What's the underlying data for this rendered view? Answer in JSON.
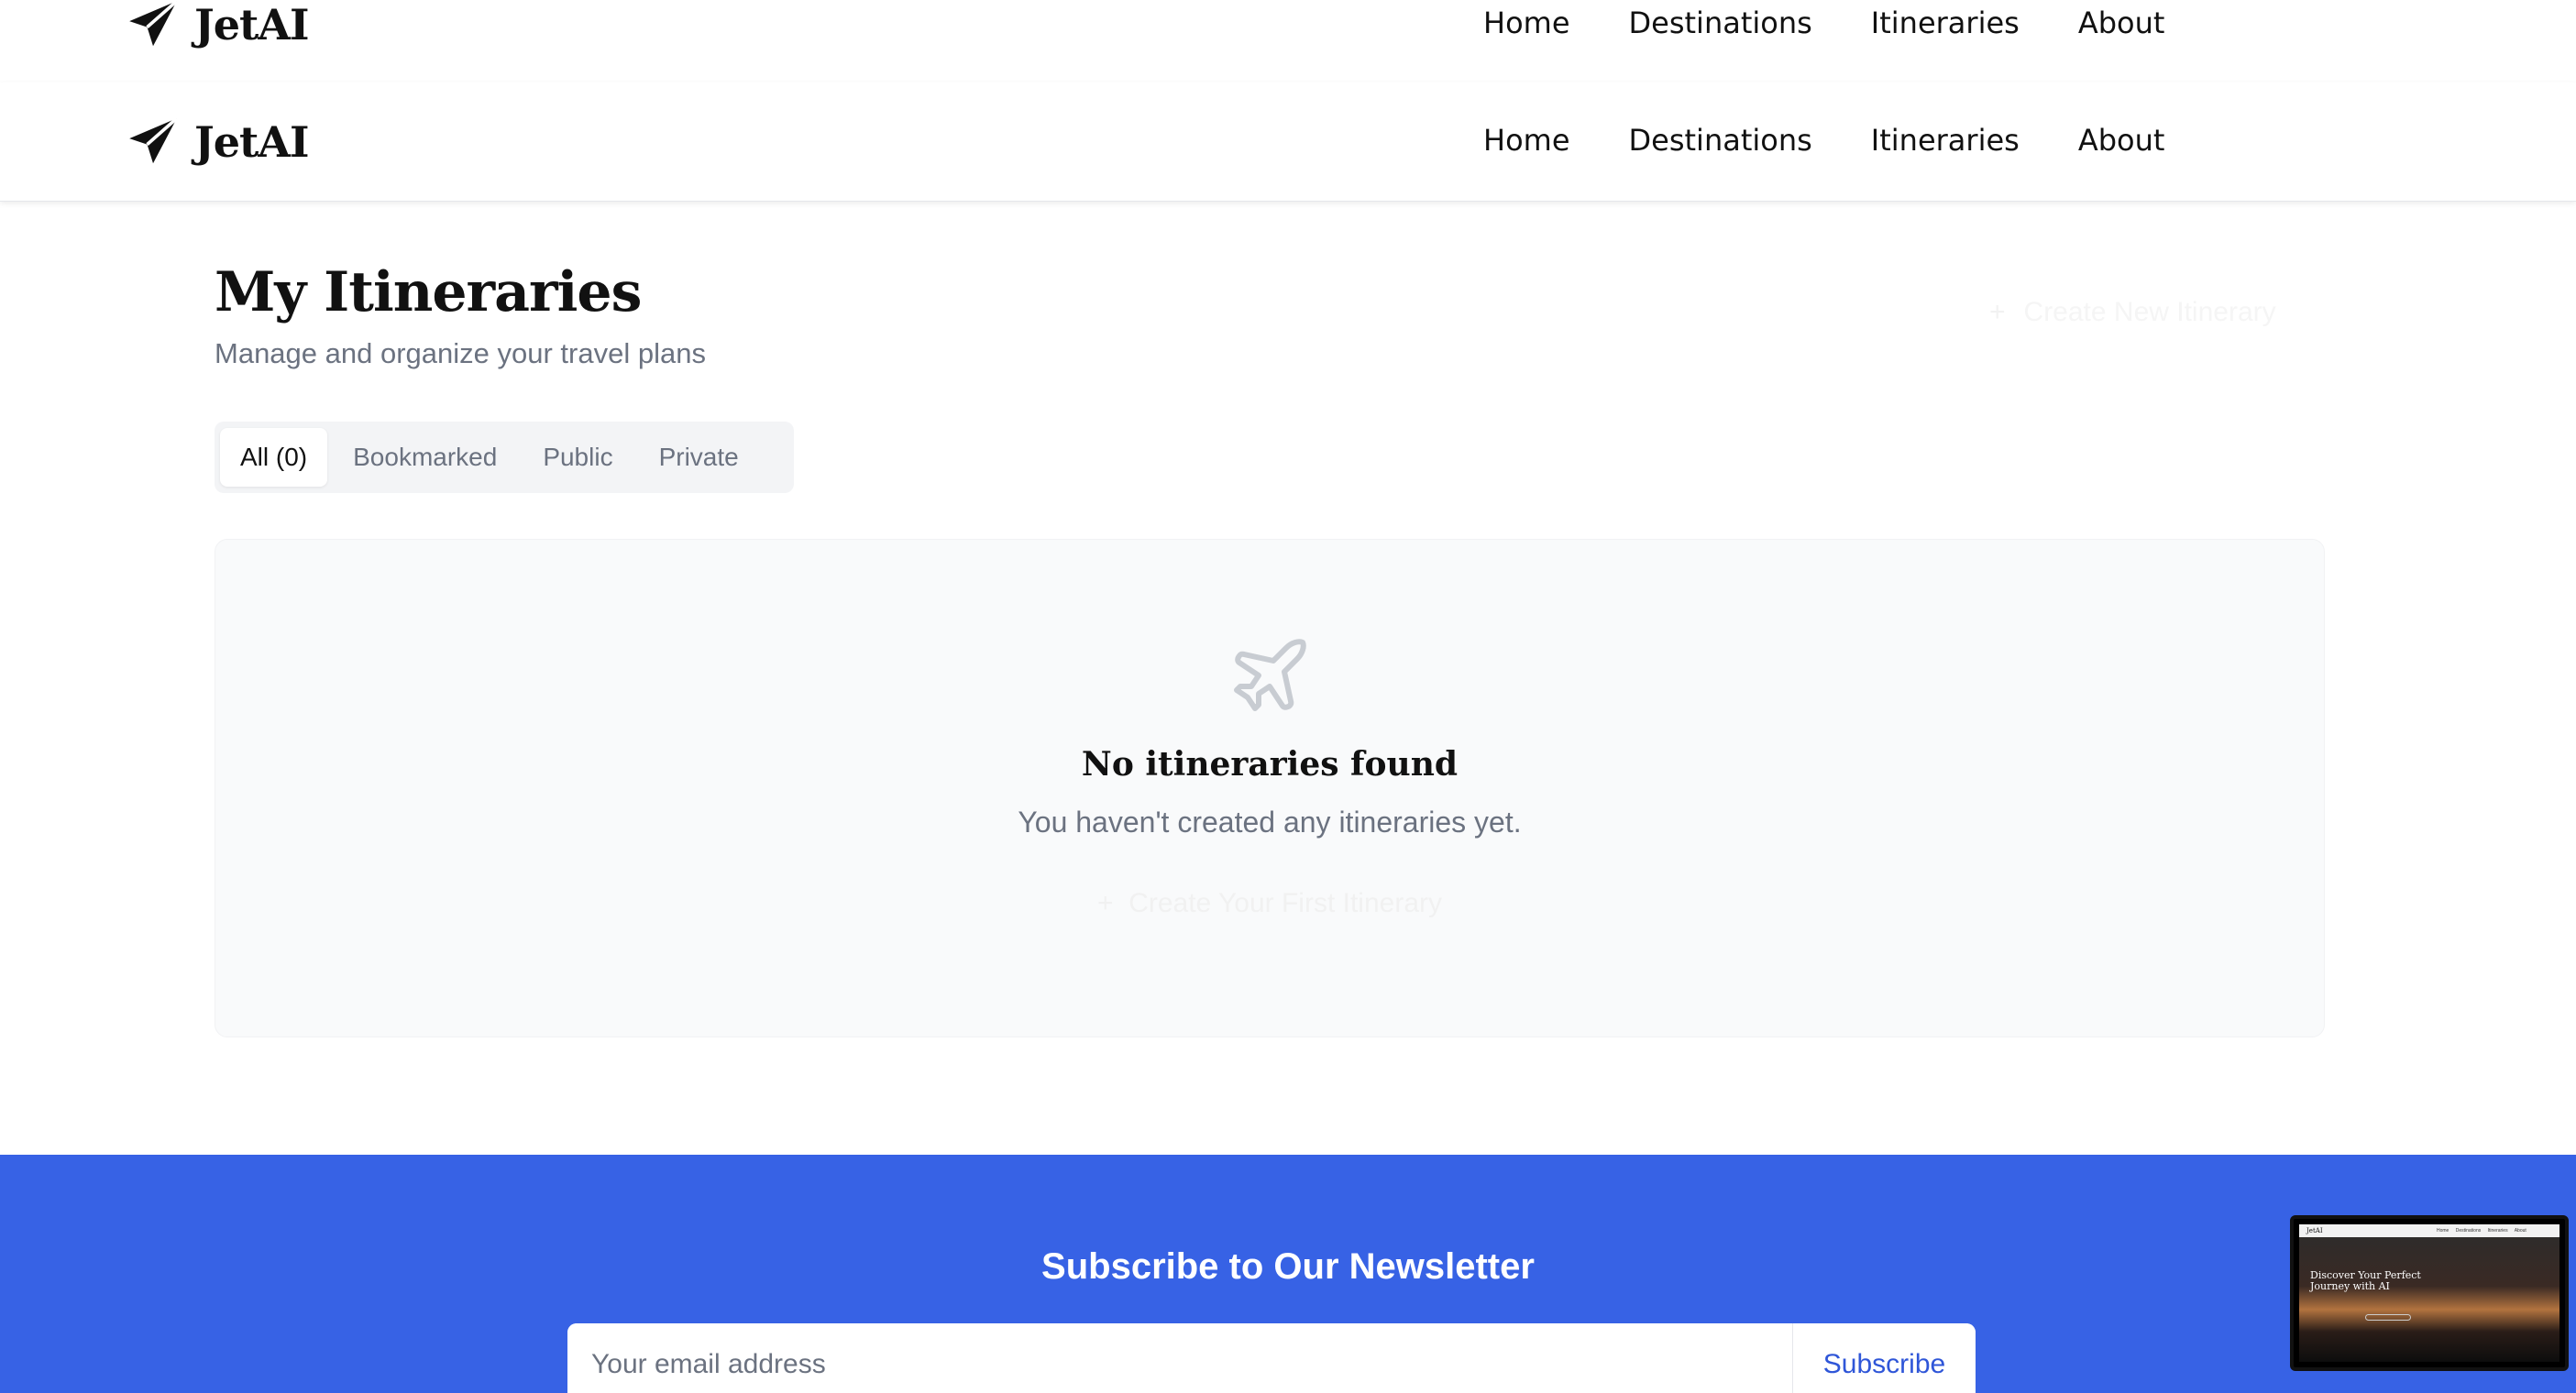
{
  "header": {
    "logo_text": "JetAI",
    "nav": [
      "Home",
      "Destinations",
      "Itineraries",
      "About"
    ]
  },
  "page": {
    "title": "My Itineraries",
    "subtitle": "Manage and organize your travel plans",
    "create_button": "Create New Itinerary"
  },
  "tabs": [
    {
      "label": "All (0)",
      "active": true
    },
    {
      "label": "Bookmarked",
      "active": false
    },
    {
      "label": "Public",
      "active": false
    },
    {
      "label": "Private",
      "active": false
    }
  ],
  "empty_state": {
    "icon": "plane-icon",
    "title": "No itineraries found",
    "text": "You haven't created any itineraries yet.",
    "create_button": "Create Your First Itinerary"
  },
  "newsletter": {
    "title": "Subscribe to Our Newsletter",
    "placeholder": "Your email address",
    "button": "Subscribe"
  },
  "preview": {
    "logo": "JetAI",
    "nav": "Home Destinations Itineraries About",
    "heading": "Discover Your Perfect Journey with AI"
  },
  "colors": {
    "accent": "#3762e5",
    "text_muted": "#6b7280",
    "card_bg": "#f9fafb"
  }
}
